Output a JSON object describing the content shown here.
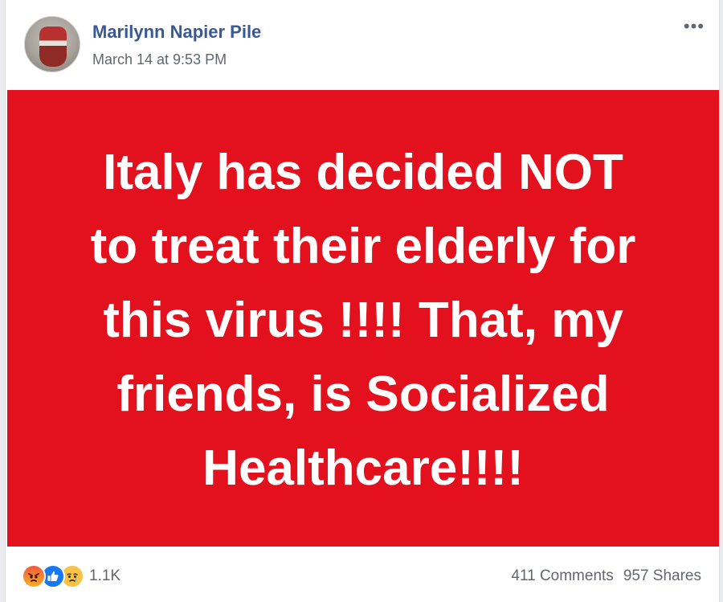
{
  "post": {
    "author": "Marilynn Napier Pile",
    "timestamp": "March 14 at 9:53 PM",
    "more_label": "•••",
    "image_text": "Italy has decided NOT\nto treat their elderly for\nthis virus !!!!  That, my\nfriends, is Socialized\nHealthcare!!!!",
    "image_background": "#e3101e"
  },
  "footer": {
    "reactions": [
      "angry-icon",
      "like-icon",
      "sad-icon"
    ],
    "reaction_count": "1.1K",
    "comments": "411 Comments",
    "shares": "957 Shares"
  },
  "colors": {
    "author_link": "#385898",
    "secondary_text": "#606770",
    "like_blue": "#1877f2"
  }
}
